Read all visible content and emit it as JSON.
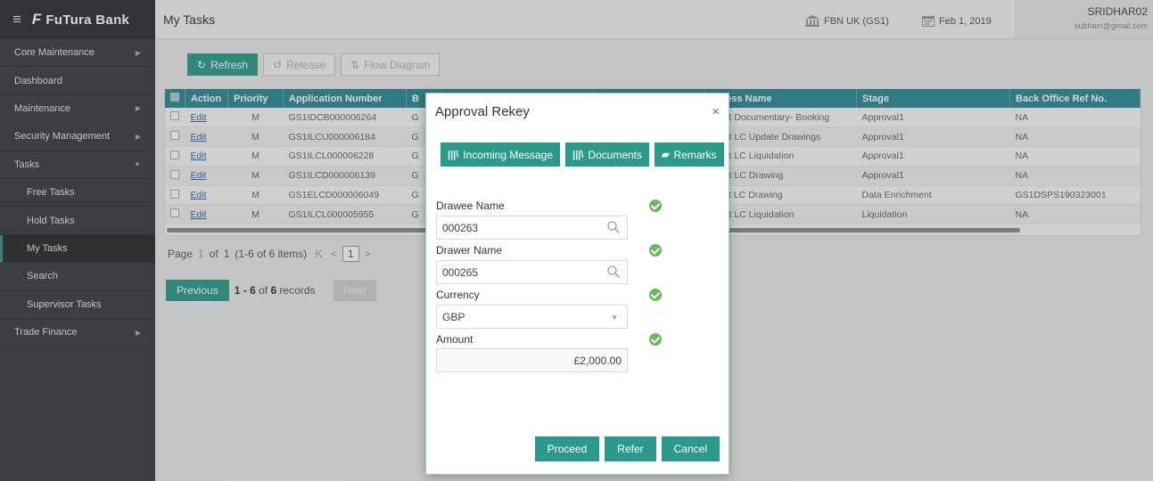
{
  "brand": {
    "name": "FuTura Bank"
  },
  "header": {
    "title": "My Tasks",
    "branch": "FBN UK",
    "branch_code": "(GS1)",
    "date": "Feb 1, 2019",
    "user": "SRIDHAR02",
    "email": "subham@gmail.com"
  },
  "sidebar": {
    "items": [
      {
        "label": "Core Maintenance",
        "arrow": "▶"
      },
      {
        "label": "Dashboard"
      },
      {
        "label": "Maintenance",
        "arrow": "▶"
      },
      {
        "label": "Security Management",
        "arrow": "▶"
      },
      {
        "label": "Tasks",
        "arrow": "▼"
      },
      {
        "label": "Free Tasks"
      },
      {
        "label": "Hold Tasks"
      },
      {
        "label": "My Tasks"
      },
      {
        "label": "Search"
      },
      {
        "label": "Supervisor Tasks"
      },
      {
        "label": "Trade Finance",
        "arrow": "▶"
      }
    ]
  },
  "toolbar": {
    "refresh": "Refresh",
    "release": "Release",
    "flow": "Flow Diagram"
  },
  "grid": {
    "headers": [
      "Action",
      "Priority",
      "Application Number",
      "B",
      "",
      "",
      "rocess Name",
      "Stage",
      "Back Office Ref No."
    ],
    "rows": [
      {
        "action": "Edit",
        "priority": "M",
        "app": "GS1IDCB000006264",
        "b": "G",
        "process": "nport Documentary- Booking",
        "stage": "Approval1",
        "ref": "NA"
      },
      {
        "action": "Edit",
        "priority": "M",
        "app": "GS1ILCU000006184",
        "b": "G",
        "process": "nport LC Update Drawings",
        "stage": "Approval1",
        "ref": "NA"
      },
      {
        "action": "Edit",
        "priority": "M",
        "app": "GS1ILCL000006228",
        "b": "G",
        "process": "nport LC Liquidation",
        "stage": "Approval1",
        "ref": "NA"
      },
      {
        "action": "Edit",
        "priority": "M",
        "app": "GS1ILCD000006139",
        "b": "G",
        "process": "nport LC Drawing",
        "stage": "Approval1",
        "ref": "NA"
      },
      {
        "action": "Edit",
        "priority": "M",
        "app": "GS1ELCD000006049",
        "b": "G",
        "process": "xport LC Drawing",
        "stage": "Data Enrichment",
        "ref": "GS1DSPS190323001"
      },
      {
        "action": "Edit",
        "priority": "M",
        "app": "GS1ILCL000005955",
        "b": "G",
        "process": "nport LC Liquidation",
        "stage": "Liquidation",
        "ref": "NA"
      }
    ]
  },
  "pager": {
    "page_label": "Page",
    "page": "1",
    "of_label": "of",
    "total": "1",
    "range": "(1-6 of 6 items)",
    "current": "1"
  },
  "records": {
    "prev": "Previous",
    "range_start": "1",
    "dash": "-",
    "range_end": "6",
    "of": "of",
    "total": "6",
    "suffix": "records",
    "next": "Next"
  },
  "modal": {
    "title": "Approval Rekey",
    "close": "×",
    "tabs": {
      "incoming": "Incoming Message",
      "documents": "Documents",
      "remarks": "Remarks"
    },
    "fields": {
      "drawee_label": "Drawee Name",
      "drawee_value": "000263",
      "drawer_label": "Drawer Name",
      "drawer_value": "000265",
      "currency_label": "Currency",
      "currency_value": "GBP",
      "amount_label": "Amount",
      "amount_value": "£2,000.00"
    },
    "buttons": {
      "proceed": "Proceed",
      "refer": "Refer",
      "cancel": "Cancel"
    }
  },
  "colors": {
    "accent": "#2b9a8c",
    "grid_header": "#2c8a95",
    "sidebar": "#3b3d41",
    "ok": "#6cb85c"
  }
}
